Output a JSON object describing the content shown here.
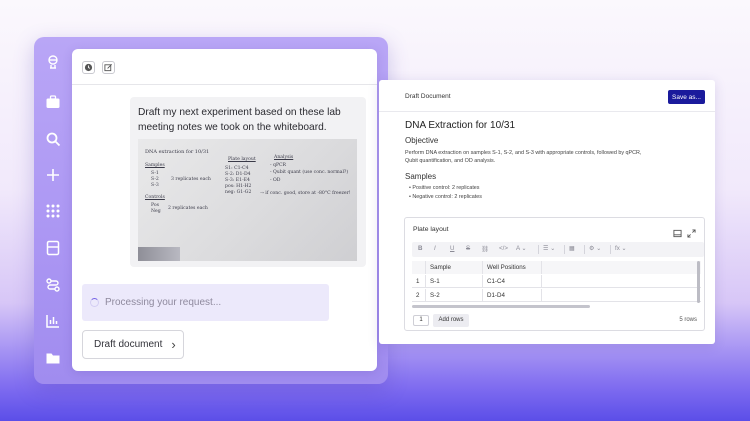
{
  "colors": {
    "accent": "#1a1a9c",
    "rail": "#ab96f3",
    "processing_bg": "#ece9fb",
    "spinner": "#7360e6"
  },
  "rail": {
    "items": [
      {
        "name": "robot-icon"
      },
      {
        "name": "briefcase-icon"
      },
      {
        "name": "search-icon"
      },
      {
        "name": "plus-icon"
      },
      {
        "name": "grid-icon"
      },
      {
        "name": "notebook-icon"
      },
      {
        "name": "workflow-icon"
      },
      {
        "name": "chart-icon"
      },
      {
        "name": "folder-icon"
      }
    ]
  },
  "chat": {
    "toolbar": [
      {
        "icon": "history-icon"
      },
      {
        "icon": "edit-icon"
      }
    ],
    "message": "Draft my next experiment based on these lab meeting notes we took on the whiteboard.",
    "whiteboard": {
      "title": "DNA extraction for 10/31",
      "samples_heading": "Samples",
      "samples": [
        "S-1",
        "S-2",
        "S-3"
      ],
      "samples_note": "3 replicates each",
      "controls_heading": "Controls",
      "controls": [
        "Pos",
        "Neg"
      ],
      "controls_note": "2 replicates each",
      "plate_heading": "Plate layout",
      "plate_lines": [
        "S1: C1-C4",
        "S-2: D1-D4",
        "S-3: E1-E4",
        "pos: H1-H2",
        "neg: G1-G2"
      ],
      "analysis_heading": "Analysis",
      "analysis_lines": [
        "- qPCR",
        "- Qubit quant (use conc. normal?)",
        "- OD",
        "→ if conc. good, store at -80°C freezer!"
      ]
    },
    "processing_text": "Processing your request...",
    "draft_button": "Draft document"
  },
  "doc": {
    "header_title": "Draft Document",
    "save_button": "Save as...",
    "title": "DNA Extraction for 10/31",
    "objective_heading": "Objective",
    "objective_text": "Perform DNA extraction on samples S-1, S-2, and S-3 with appropriate controls, followed by qPCR, Qubit quantification, and OD analysis.",
    "samples_heading": "Samples",
    "bullets": [
      "Positive control: 2 replicates",
      "Negative control: 2 replicates"
    ],
    "plate": {
      "title": "Plate layout",
      "toolbar": [
        "B",
        "I",
        "U",
        "S",
        "A",
        "fx"
      ],
      "headers": [
        "Sample",
        "Well Positions"
      ],
      "rows": [
        {
          "num": "1",
          "sample": "S-1",
          "wells": "C1-C4"
        },
        {
          "num": "2",
          "sample": "S-2",
          "wells": "D1-D4"
        }
      ],
      "add_count": "1",
      "add_rows_label": "Add rows",
      "rows_count": "5 rows"
    }
  }
}
